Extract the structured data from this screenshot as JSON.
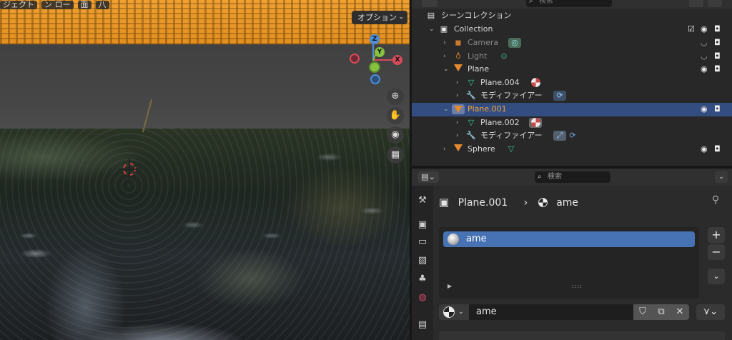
{
  "viewport": {
    "header_partial": [
      "ジェクト",
      "ン ロー",
      "面",
      "八"
    ],
    "options_label": "オプション",
    "gizmo": {
      "z": "Z",
      "y": "Y",
      "x": "X"
    },
    "nav_icons": [
      "zoom-icon",
      "hand-icon",
      "camera-icon",
      "grid-icon"
    ]
  },
  "outliner": {
    "search_placeholder": "検索",
    "rows": [
      {
        "label": "シーンコレクション"
      },
      {
        "label": "Collection"
      },
      {
        "label": "Camera"
      },
      {
        "label": "Light"
      },
      {
        "label": "Plane"
      },
      {
        "label": "Plane.004"
      },
      {
        "label": "モディファイアー"
      },
      {
        "label": "Plane.001"
      },
      {
        "label": "Plane.002"
      },
      {
        "label": "モディファイアー"
      },
      {
        "label": "Sphere"
      }
    ]
  },
  "properties": {
    "search_placeholder": "検索",
    "breadcrumb": {
      "object": "Plane.001",
      "material": "ame"
    },
    "slot_name": "ame",
    "material_name": "ame",
    "colors": {
      "selected_row": "#334d80",
      "active_slot": "#4772b3",
      "accent_orange": "#e38a2e"
    }
  }
}
